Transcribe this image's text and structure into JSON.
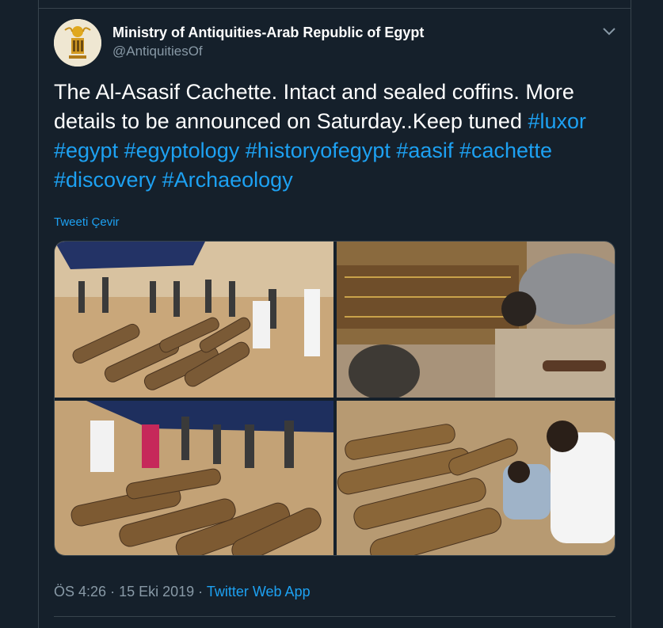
{
  "account": {
    "name": "Ministry of Antiquities-Arab Republic of Egypt",
    "handle": "@AntiquitiesOf",
    "avatar_icon": "sun-disk-emblem-icon"
  },
  "tweet": {
    "text_plain": "The Al-Asasif Cachette. Intact and sealed coffins. More details to be announced on Saturday..Keep tuned",
    "hashtags": [
      "#luxor",
      "#egypt",
      "#egyptology",
      "#historyofegypt",
      "#aasif",
      "#cachette",
      "#discovery",
      "#Archaeology"
    ],
    "translate_label": "Tweeti Çevir"
  },
  "media": {
    "photo_count": 4
  },
  "meta": {
    "time": "ÖS 4:26",
    "separator": "·",
    "date": "15 Eki 2019",
    "app": "Twitter Web App"
  },
  "colors": {
    "background": "#15202b",
    "link": "#1da1f2",
    "muted": "#8899a6",
    "border": "#38444d"
  }
}
